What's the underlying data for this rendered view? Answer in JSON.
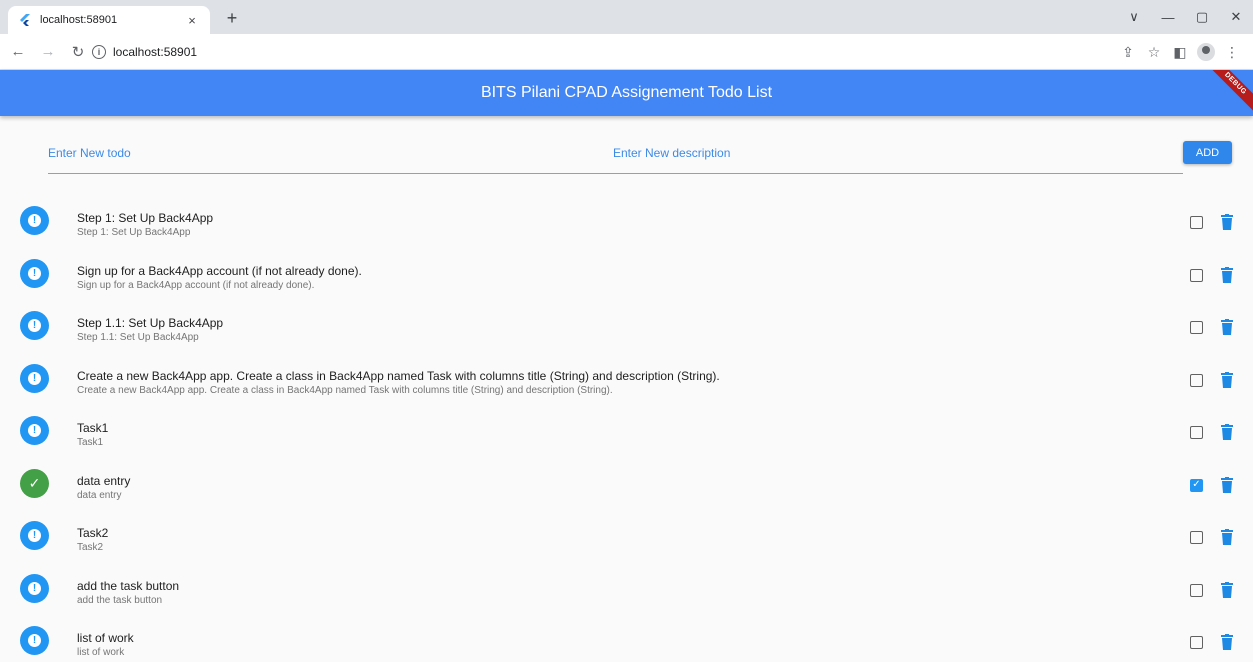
{
  "browser": {
    "tab_title": "localhost:58901",
    "tab_close": "×",
    "new_tab": "+",
    "url": "localhost:58901",
    "win_controls": [
      "∨",
      "—",
      "▢",
      "✕"
    ]
  },
  "app": {
    "title": "BITS Pilani CPAD Assignement Todo List",
    "debug_banner": "DEBUG",
    "todo_placeholder": "Enter New todo",
    "description_placeholder": "Enter New description",
    "add_label": "ADD",
    "accent_color": "#4285f4",
    "tasks": [
      {
        "title": "Step 1: Set Up Back4App",
        "description": "Step 1: Set Up Back4App",
        "done": false
      },
      {
        "title": "Sign up for a Back4App account (if not already done).",
        "description": "Sign up for a Back4App account (if not already done).",
        "done": false
      },
      {
        "title": "Step 1.1: Set Up Back4App",
        "description": "Step 1.1: Set Up Back4App",
        "done": false
      },
      {
        "title": "Create a new Back4App app. Create a class in Back4App named Task with columns title (String) and description (String).",
        "description": "Create a new Back4App app. Create a class in Back4App named Task with columns title (String) and description (String).",
        "done": false
      },
      {
        "title": "Task1",
        "description": "Task1",
        "done": false
      },
      {
        "title": "data entry",
        "description": "data entry",
        "done": true
      },
      {
        "title": "Task2",
        "description": "Task2",
        "done": false
      },
      {
        "title": "add the task button",
        "description": "add the task button",
        "done": false
      },
      {
        "title": "list of work",
        "description": "list of work",
        "done": false
      }
    ]
  }
}
